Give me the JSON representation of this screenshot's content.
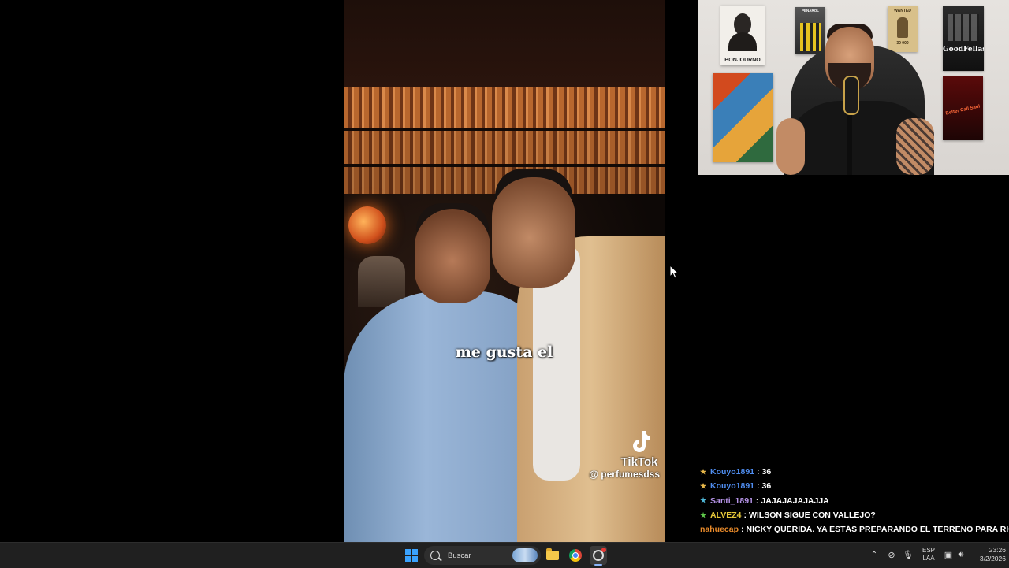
{
  "video": {
    "subtitle": "me gusta el",
    "tiktok_brand": "TikTok",
    "tiktok_handle": "@ perfumesdss"
  },
  "webcam": {
    "poster_left_caption": "BONJOURNO",
    "poster_center_caption": "PEÑAROL",
    "poster_wanted_top": "WANTED",
    "poster_wanted_bottom": "30 000",
    "poster_right_caption": "GoodFellas",
    "poster_red_caption": "Better Call Saul"
  },
  "chat": {
    "messages": [
      {
        "user": "Kouyo1891",
        "text": "36",
        "user_color": "#4f8df0",
        "star_color": "#e8b84a"
      },
      {
        "user": "Kouyo1891",
        "text": "36",
        "user_color": "#4f8df0",
        "star_color": "#e8b84a"
      },
      {
        "user": "Santi_1891",
        "text": "JAJAJAJAJAJJA",
        "user_color": "#b694e8",
        "star_color": "#4fb8d8"
      },
      {
        "user": "ALVEZ4",
        "text": "WILSON SIGUE CON VALLEJO?",
        "user_color": "#e6c83a",
        "star_color": "#5ec84a"
      },
      {
        "user": "nahuecap",
        "text": "NICKY QUERIDA. YA ESTÁS PREPARANDO EL TERRENO PARA RIO",
        "user_color": "#e88a2a",
        "star_color": ""
      }
    ]
  },
  "taskbar": {
    "search_label": "Buscar",
    "lang_top": "ESP",
    "lang_bottom": "LAA",
    "time": "23:26",
    "date": "3/2/2026"
  }
}
